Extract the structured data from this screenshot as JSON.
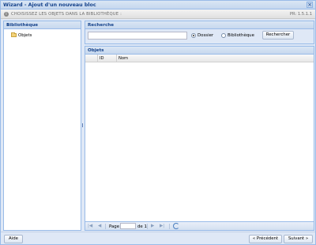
{
  "window": {
    "title": "Wizard - Ajout d'un nouveau bloc",
    "close_glyph": "×"
  },
  "subbar": {
    "info_glyph": "i",
    "message": "CHOISISSEZ LES OBJETS DANS LA BIBLIOTHÈQUE :",
    "version": "PR: 1.5.1.1"
  },
  "library": {
    "title": "Bibliothèque",
    "collapse_glyph": "«",
    "items": [
      {
        "label": "Objets",
        "icon": "folder-icon"
      }
    ]
  },
  "search": {
    "title": "Recherche",
    "input_value": "",
    "radios": [
      {
        "label": "Dossier",
        "checked": true
      },
      {
        "label": "Bibliothèque",
        "checked": false
      }
    ],
    "button_label": "Rechercher"
  },
  "objects": {
    "title": "Objets",
    "columns": [
      "ID",
      "Nom"
    ],
    "rows": []
  },
  "pager": {
    "first_glyph": "|◀",
    "prev_glyph": "◀",
    "page_label": "Page",
    "page_value": "",
    "of_label": "de 1",
    "next_glyph": "▶",
    "last_glyph": "▶|"
  },
  "footer": {
    "help_label": "Aide",
    "prev_label": "« Précédent",
    "next_label": "Suivant »"
  }
}
